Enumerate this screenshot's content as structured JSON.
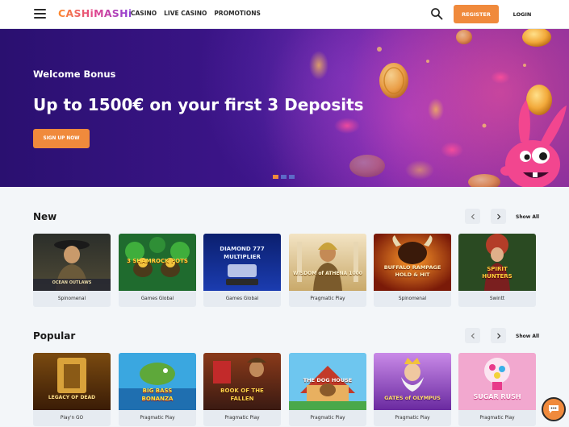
{
  "header": {
    "logo_text": "CASHiMASHi",
    "nav": [
      "CASINO",
      "LIVE CASINO",
      "PROMOTIONS"
    ],
    "register_label": "REGISTER",
    "login_label": "LOGIN"
  },
  "hero": {
    "subtitle": "Welcome Bonus",
    "title": "Up to 1500€ on your first 3 Deposits",
    "cta_label": "SIGN UP NOW",
    "slides_count": 3,
    "active_slide": 1
  },
  "sections": [
    {
      "title": "New",
      "show_all_label": "Show All",
      "games": [
        {
          "thumb_text": "OCEAN OUTLAWS",
          "provider": "Spinomenal"
        },
        {
          "thumb_text": "3 SHAMROCK POTS",
          "provider": "Games Global"
        },
        {
          "thumb_text": "DIAMOND 777 MULTIPLIER",
          "provider": "Games Global"
        },
        {
          "thumb_text": "WISDOM of ATHENA 1000",
          "provider": "Pragmatic Play"
        },
        {
          "thumb_text": "BUFFALO RAMPAGE HOLD & HIT",
          "provider": "Spinomenal"
        },
        {
          "thumb_text": "SPIRIT HUNTERS",
          "provider": "Swintt"
        }
      ]
    },
    {
      "title": "Popular",
      "show_all_label": "Show All",
      "games": [
        {
          "thumb_text": "LEGACY OF DEAD",
          "provider": "Play'n GO"
        },
        {
          "thumb_text": "BIG BASS BONANZA",
          "provider": "Pragmatic Play"
        },
        {
          "thumb_text": "BOOK OF THE FALLEN",
          "provider": "Pragmatic Play"
        },
        {
          "thumb_text": "THE DOG HOUSE",
          "provider": "Pragmatic Play"
        },
        {
          "thumb_text": "GATES of OLYMPUS",
          "provider": "Pragmatic Play"
        },
        {
          "thumb_text": "SUGAR RUSH",
          "provider": "Pragmatic Play"
        }
      ]
    }
  ],
  "colors": {
    "accent": "#f08a3c",
    "hero_dark": "#2a1070",
    "card_bg": "#e6ebf1",
    "page_bg": "#f3f6f9"
  },
  "icons": [
    "hamburger-icon",
    "search-icon",
    "chevron-left-icon",
    "chevron-right-icon",
    "chat-icon"
  ]
}
